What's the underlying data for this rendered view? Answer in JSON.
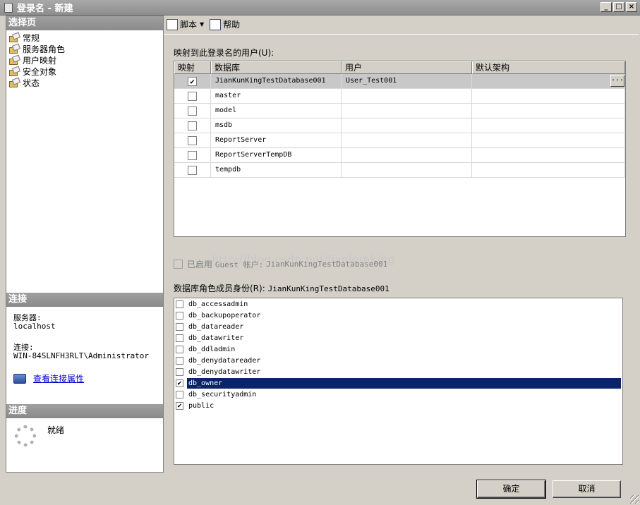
{
  "window": {
    "title": "登录名 - 新建",
    "controls": [
      "_",
      "□",
      "×"
    ]
  },
  "left": {
    "select_page_header": "选择页",
    "nav_items": [
      {
        "label": "常规"
      },
      {
        "label": "服务器角色"
      },
      {
        "label": "用户映射"
      },
      {
        "label": "安全对象"
      },
      {
        "label": "状态"
      }
    ],
    "connection_header": "连接",
    "server_label": "服务器:",
    "server_value": "localhost",
    "connection_label": "连接:",
    "connection_value": "WIN-84SLNFH3RLT\\Administrator",
    "view_conn_props": "查看连接属性",
    "progress_header": "进度",
    "progress_status": "就绪"
  },
  "toolbar": {
    "script_label": "脚本",
    "help_label": "帮助"
  },
  "mapping": {
    "label": "映射到此登录名的用户(U):",
    "columns": [
      "映射",
      "数据库",
      "用户",
      "默认架构"
    ],
    "rows": [
      {
        "mapped": true,
        "database": "JianKunKingTestDatabase001",
        "user": "User_Test001",
        "schema": "",
        "button": "..."
      },
      {
        "mapped": false,
        "database": "master",
        "user": "",
        "schema": ""
      },
      {
        "mapped": false,
        "database": "model",
        "user": "",
        "schema": ""
      },
      {
        "mapped": false,
        "database": "msdb",
        "user": "",
        "schema": ""
      },
      {
        "mapped": false,
        "database": "ReportServer",
        "user": "",
        "schema": ""
      },
      {
        "mapped": false,
        "database": "ReportServerTempDB",
        "user": "",
        "schema": ""
      },
      {
        "mapped": false,
        "database": "tempdb",
        "user": "",
        "schema": ""
      }
    ]
  },
  "guest": {
    "label_prefix": "已启用",
    "label_account": "Guest 帐户:",
    "database": "JianKunKingTestDatabase001"
  },
  "watermark": "http://blog.csdn.net/jiankunking",
  "roles": {
    "label": "数据库角色成员身份(R):",
    "database": "JianKunKingTestDatabase001",
    "items": [
      {
        "name": "db_accessadmin",
        "checked": false
      },
      {
        "name": "db_backupoperator",
        "checked": false
      },
      {
        "name": "db_datareader",
        "checked": false
      },
      {
        "name": "db_datawriter",
        "checked": false
      },
      {
        "name": "db_ddladmin",
        "checked": false
      },
      {
        "name": "db_denydatareader",
        "checked": false
      },
      {
        "name": "db_denydatawriter",
        "checked": false
      },
      {
        "name": "db_owner",
        "checked": true,
        "selected": true
      },
      {
        "name": "db_securityadmin",
        "checked": false
      },
      {
        "name": "public",
        "checked": true
      }
    ]
  },
  "buttons": {
    "ok": "确定",
    "cancel": "取消"
  },
  "check_mark": "✔"
}
